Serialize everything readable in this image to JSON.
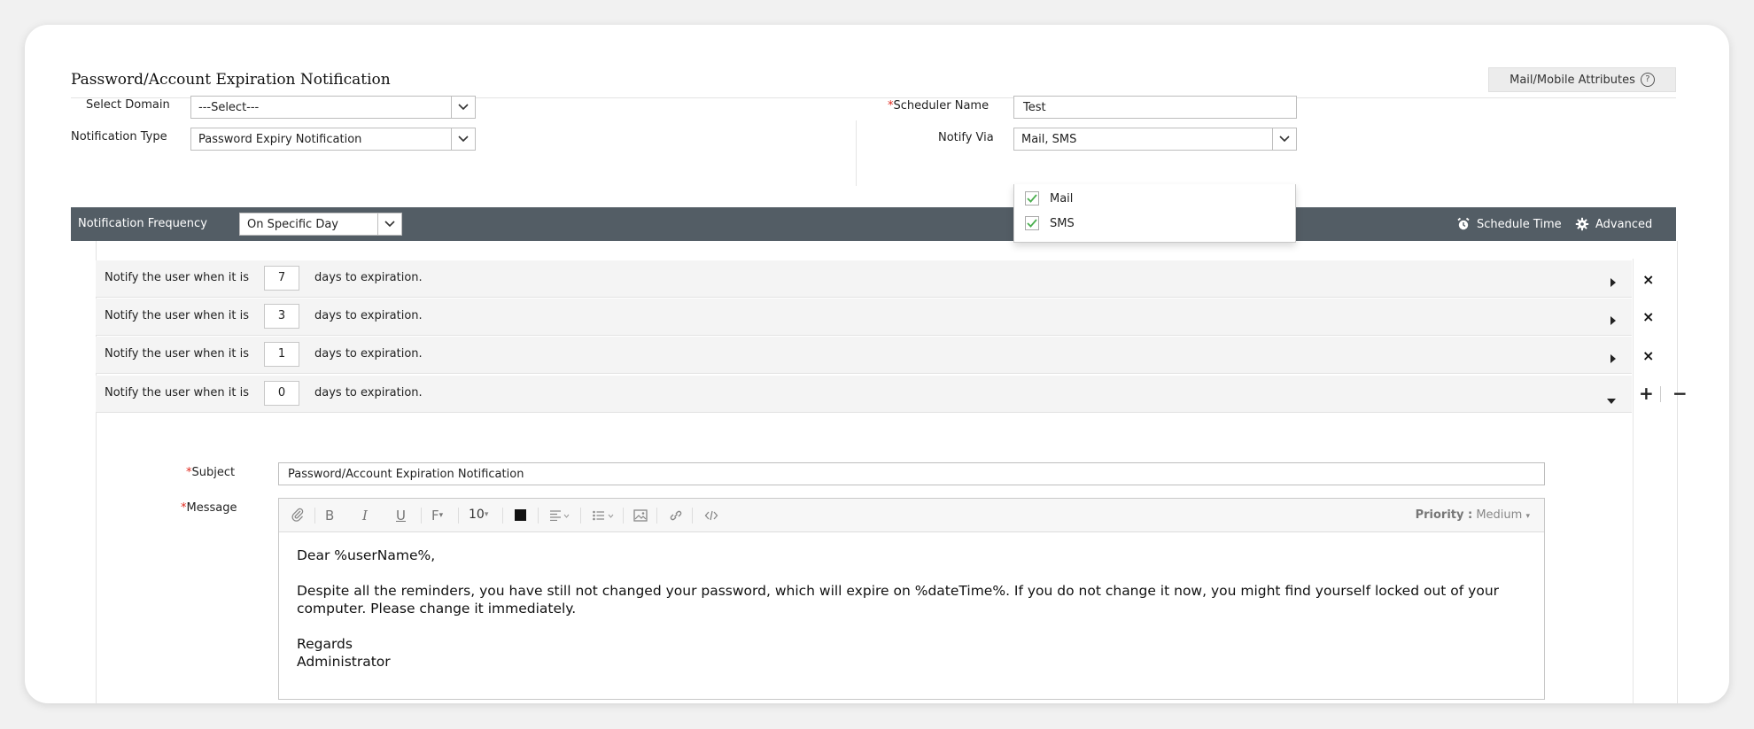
{
  "header": {
    "title": "Password/Account Expiration Notification",
    "attributes_button": "Mail/Mobile Attributes",
    "help_glyph": "?"
  },
  "form": {
    "domain_label": "Select Domain",
    "domain_value": "---Select---",
    "notification_type_label": "Notification Type",
    "notification_type_value": "Password Expiry Notification",
    "scheduler_name_label": "Scheduler Name",
    "scheduler_name_value": "Test",
    "notify_via_label": "Notify Via",
    "notify_via_value": "Mail, SMS",
    "required_mark": "*"
  },
  "notify_via_options": [
    {
      "label": "Mail",
      "checked": true
    },
    {
      "label": "SMS",
      "checked": true
    }
  ],
  "frequency": {
    "label": "Notification Frequency",
    "value": "On Specific Day",
    "schedule_time": "Schedule Time",
    "advanced": "Advanced"
  },
  "rules": [
    {
      "prefix": "Notify the user when it is",
      "days": "7",
      "suffix": "days to expiration.",
      "expanded": false
    },
    {
      "prefix": "Notify the user when it is",
      "days": "3",
      "suffix": "days to expiration.",
      "expanded": false
    },
    {
      "prefix": "Notify the user when it is",
      "days": "1",
      "suffix": "days to expiration.",
      "expanded": false
    },
    {
      "prefix": "Notify the user when it is",
      "days": "0",
      "suffix": "days to expiration.",
      "expanded": true
    }
  ],
  "row_actions": {
    "remove": "×",
    "add": "+",
    "minus": "−"
  },
  "editor": {
    "subject_label": "Subject",
    "subject_value": "Password/Account Expiration Notification",
    "message_label": "Message",
    "font_size": "10",
    "font_glyph": "F",
    "bold_glyph": "B",
    "italic_glyph": "I",
    "underline_glyph": "U",
    "priority_label": "Priority :",
    "priority_value": "Medium",
    "message_lines": {
      "greeting": "Dear %userName%,",
      "body": "Despite all the reminders, you have still not changed your password, which will expire on %dateTime%. If you do not change it now, you might find yourself locked out of your computer. Please change it immediately.",
      "closing1": "Regards",
      "closing2": "Administrator"
    }
  },
  "colors": {
    "bar": "#535d65",
    "required": "#e0281d",
    "check": "#4caf50"
  }
}
